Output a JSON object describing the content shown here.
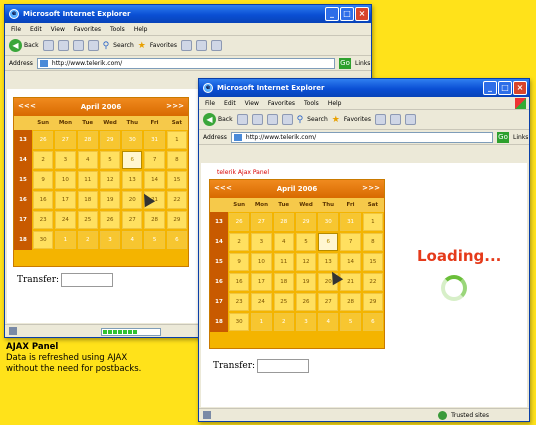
{
  "window1": {
    "title": "Microsoft Internet Explorer",
    "menu": [
      "File",
      "Edit",
      "View",
      "Favorites",
      "Tools",
      "Help"
    ],
    "toolbar": {
      "back_label": "Back",
      "search_label": "Search",
      "favorites_label": "Favorites"
    },
    "address": {
      "label": "Address",
      "url": "http://www.telerik.com/",
      "go_label": "Go",
      "links_label": "Links"
    },
    "calendar": {
      "month_title": "April 2006",
      "nav": {
        "prev2": "<<",
        "prev": "<",
        "next": ">",
        "next2": ">>"
      },
      "day_names": [
        "Sun",
        "Mon",
        "Tue",
        "Wed",
        "Thu",
        "Fri",
        "Sat"
      ],
      "weeks": [
        {
          "num": "13",
          "days": [
            "26",
            "27",
            "28",
            "29",
            "30",
            "31",
            "1"
          ]
        },
        {
          "num": "14",
          "days": [
            "2",
            "3",
            "4",
            "5",
            "6",
            "7",
            "8"
          ]
        },
        {
          "num": "15",
          "days": [
            "9",
            "10",
            "11",
            "12",
            "13",
            "14",
            "15"
          ]
        },
        {
          "num": "16",
          "days": [
            "16",
            "17",
            "18",
            "19",
            "20",
            "21",
            "22"
          ]
        },
        {
          "num": "17",
          "days": [
            "23",
            "24",
            "25",
            "26",
            "27",
            "28",
            "29"
          ]
        },
        {
          "num": "18",
          "days": [
            "30",
            "1",
            "2",
            "3",
            "4",
            "5",
            "6"
          ]
        }
      ],
      "selected_day": "6"
    },
    "transfer_label": "Transfer:",
    "status": {
      "progress": 0.6
    }
  },
  "window2": {
    "title": "Microsoft Internet Explorer",
    "menu": [
      "File",
      "Edit",
      "View",
      "Favorites",
      "Tools",
      "Help"
    ],
    "toolbar": {
      "back_label": "Back",
      "search_label": "Search",
      "favorites_label": "Favorites"
    },
    "address": {
      "label": "Address",
      "url": "http://www.telerik.com/",
      "go_label": "Go",
      "links_label": "Links"
    },
    "ajax_link": "telerik Ajax Panel",
    "loading_text": "Loading...",
    "transfer_label": "Transfer:",
    "status": {
      "trusted": "Trusted sites"
    }
  },
  "caption": {
    "title": "AJAX Panel",
    "line1": "Data is refreshed using AJAX",
    "line2": "without the need for postbacks."
  },
  "colors": {
    "background": "#ffe21a",
    "accent": "#f4b400",
    "loading": "#e53a1a"
  }
}
